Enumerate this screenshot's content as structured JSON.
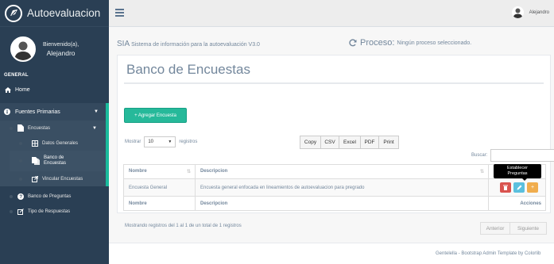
{
  "sidebar": {
    "brand_title": "Autoevaluacion",
    "welcome": "Bienvenido(a),",
    "user_name": "Alejandro",
    "section_title": "GENERAL",
    "home": "Home",
    "fuentes_primarias": "Fuentes Primarias",
    "encuestas": "Encuestas",
    "datos_generales": "Datos Generales",
    "banco_encuestas_line1": "Banco de",
    "banco_encuestas_line2": "Encuestas",
    "vincular_encuestas": "Vincular Encuestas",
    "banco_preguntas": "Banco de Preguntas",
    "tipo_respuestas": "Tipo de Respuestas"
  },
  "topnav": {
    "user_name": "Alejandro"
  },
  "header": {
    "sia_short": "SIA",
    "sia_long": "Sistema de información para la autoevaluación V3.0",
    "proceso_label": "Proceso:",
    "proceso_value": "Ningún proceso seleccionado."
  },
  "panel": {
    "title": "Banco de Encuestas",
    "add_button": "+ Agregar Encuesta",
    "show_label": "Mostrar",
    "show_value": "10",
    "records_label": "registros",
    "export_buttons": [
      "Copy",
      "CSV",
      "Excel",
      "PDF",
      "Print"
    ],
    "search_label": "Buscar:",
    "search_value": "",
    "columns": [
      "Nombre",
      "Descripcion",
      "Acciones"
    ],
    "rows": [
      {
        "nombre": "Encuesta General",
        "descripcion": "Encuesta general enfocada en lineamientos de autoevaluacion para pregrado"
      }
    ],
    "tooltip_line1": "Establecer",
    "tooltip_line2": "Preguntas",
    "info": "Mostrando registros del 1 al 1 de un total de 1 registros",
    "pager_prev": "Anterior",
    "pager_next": "Siguiente"
  },
  "footer": {
    "text": "Gentelella - Bootstrap Admin Template by Colorlib"
  },
  "colors": {
    "sidebar_bg": "#2a3f54",
    "accent_green": "#26b99a",
    "danger": "#d9534f",
    "info": "#5bc0de",
    "warning": "#f0ad4e"
  }
}
